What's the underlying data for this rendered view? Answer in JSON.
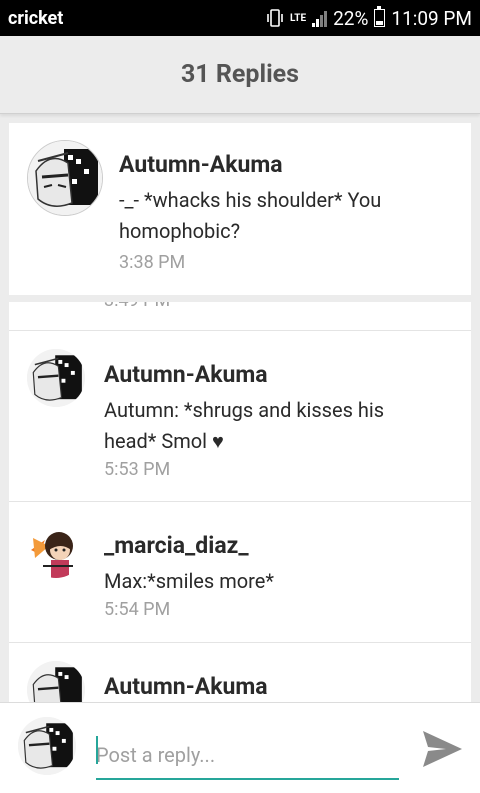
{
  "status_bar": {
    "carrier": "cricket",
    "network": "LTE",
    "battery": "22%",
    "time": "11:09 PM"
  },
  "header": {
    "title": "31 Replies"
  },
  "main_comment": {
    "author": "Autumn-Akuma",
    "text": "-_- *whacks his shoulder* You homophobic?",
    "time": "3:38 PM"
  },
  "replies": [
    {
      "author": "Autumn-Akuma",
      "text": "Autumn: *shrugs and kisses his head* Smol ♥",
      "time": "5:53 PM"
    },
    {
      "author": "_marcia_diaz_",
      "text": "Max:*smiles more*",
      "time": "5:54 PM"
    },
    {
      "author": "Autumn-Akuma"
    }
  ],
  "reply_bar": {
    "placeholder": "Post a reply..."
  },
  "colors": {
    "accent": "#26a69a",
    "send_icon": "#8a8a8a"
  }
}
